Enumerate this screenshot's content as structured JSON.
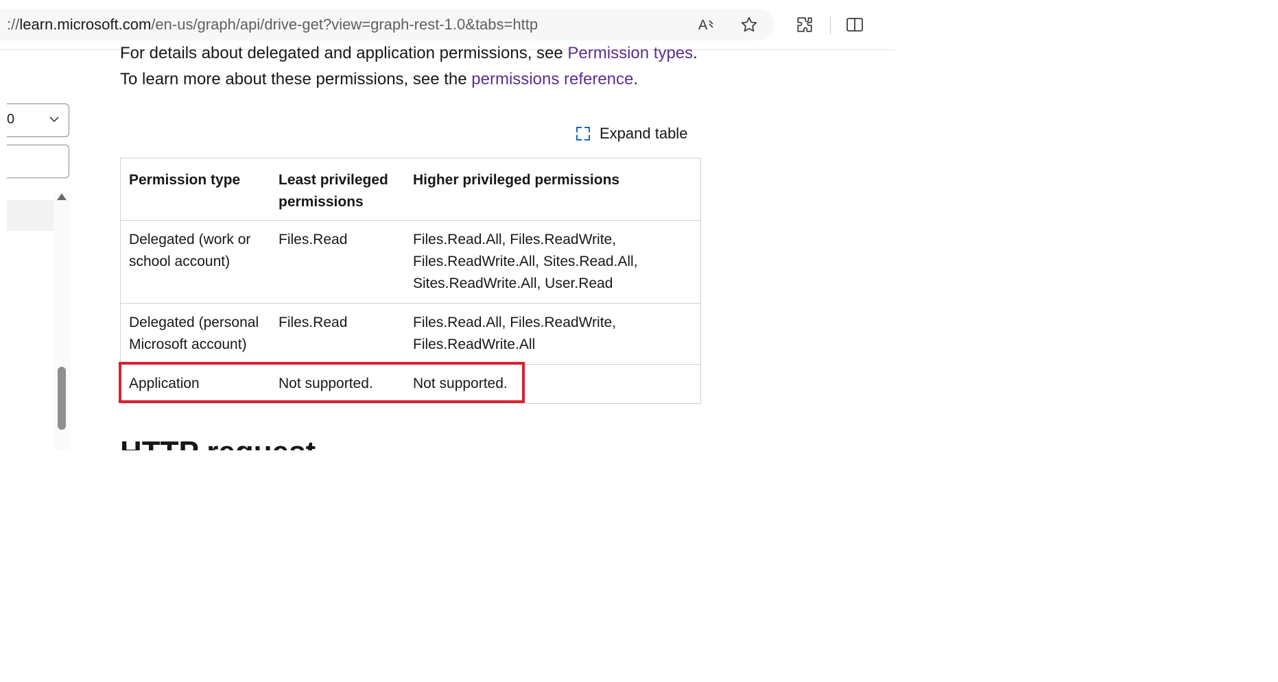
{
  "browser": {
    "url_prefix": "://",
    "url_host": "learn.microsoft.com",
    "url_path": "/en-us/graph/api/drive-get?view=graph-rest-1.0&tabs=http",
    "read_aloud_glyph": "A",
    "icons": [
      "read-aloud-icon",
      "favorite-star-icon",
      "extensions-icon",
      "split-screen-icon"
    ]
  },
  "sidebar": {
    "version_select_value": "0"
  },
  "content": {
    "line1_text": "For details about delegated and application permissions, see ",
    "line1_link": "Permission types",
    "line1_end": ".",
    "line2_text": "To learn more about these permissions, see the ",
    "line2_link": "permissions reference",
    "line2_end": ".",
    "expand_table_label": "Expand table",
    "next_heading": "HTTP request"
  },
  "table": {
    "headers": [
      "Permission type",
      "Least privileged permissions",
      "Higher privileged permissions"
    ],
    "rows": [
      [
        "Delegated (work or school account)",
        "Files.Read",
        "Files.Read.All, Files.ReadWrite, Files.ReadWrite.All, Sites.Read.All, Sites.ReadWrite.All, User.Read"
      ],
      [
        "Delegated (personal Microsoft account)",
        "Files.Read",
        "Files.Read.All, Files.ReadWrite, Files.ReadWrite.All"
      ],
      [
        "Application",
        "Not supported.",
        "Not supported."
      ]
    ]
  },
  "colors": {
    "link": "#5c2e91",
    "highlight_border": "#d9202e",
    "accent_icon": "#0f6cbd"
  }
}
